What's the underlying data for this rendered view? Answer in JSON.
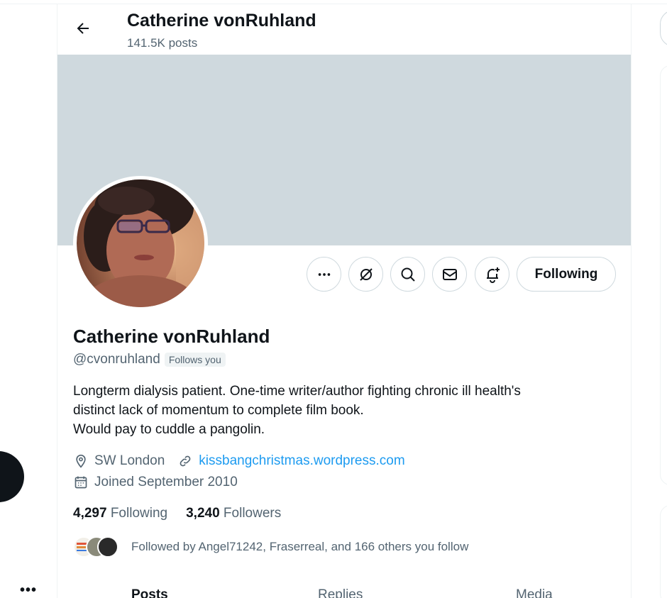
{
  "header": {
    "name": "Catherine vonRuhland",
    "posts": "141.5K posts"
  },
  "profile": {
    "name": "Catherine vonRuhland",
    "handle": "@cvonruhland",
    "follows_you": "Follows you",
    "bio": [
      "Longterm dialysis patient. One-time writer/author fighting chronic ill health's",
      "distinct lack of momentum to complete film book.",
      "Would pay to cuddle a pangolin."
    ],
    "location": "SW London",
    "website": "kissbangchristmas.wordpress.com",
    "joined": "Joined September 2010",
    "following_count": "4,297",
    "following_label": "Following",
    "followers_count": "3,240",
    "followers_label": "Followers",
    "followed_by": "Followed by Angel71242, Fraserreal, and 166 others you follow"
  },
  "actions": {
    "more": "more-icon",
    "grok": "grok-icon",
    "search": "search-icon",
    "message": "mail-icon",
    "notify": "bell-plus-icon",
    "following_label": "Following"
  },
  "tabs": [
    "Posts",
    "Replies",
    "Media"
  ],
  "colors": {
    "banner": "#cfd9de",
    "link": "#1d9bf0",
    "secondary_text": "#536471",
    "primary_text": "#0f1419"
  }
}
